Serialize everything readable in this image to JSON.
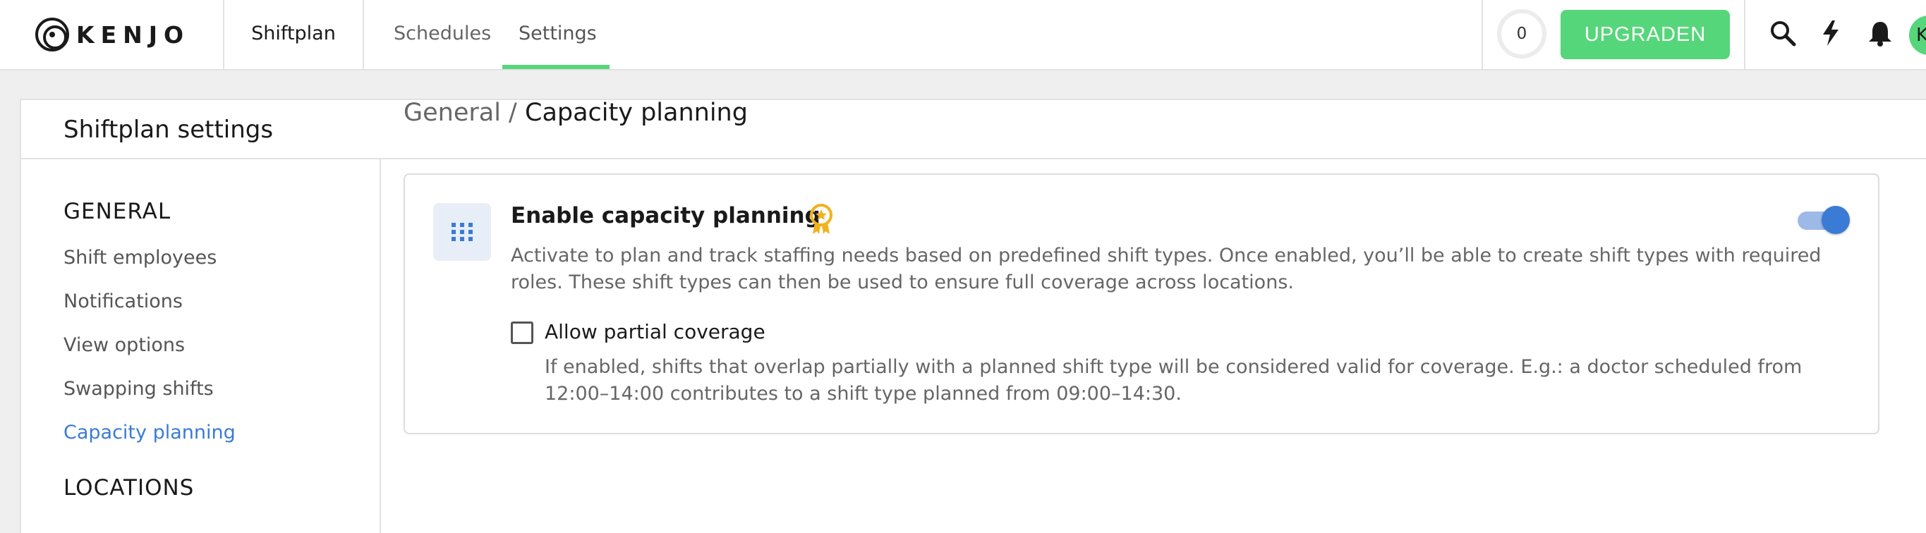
{
  "header": {
    "logo_text": "KENJO",
    "app_section": "Shiftplan",
    "tabs": [
      {
        "label": "Schedules"
      },
      {
        "label": "Settings",
        "active": true
      }
    ],
    "counter": "0",
    "upgrade_label": "UPGRADEN",
    "avatar_initial": "K",
    "icons": [
      "search-icon",
      "lightning-icon",
      "bell-icon"
    ]
  },
  "page": {
    "title": "Shiftplan settings"
  },
  "sidebar": {
    "general_heading": "GENERAL",
    "items": [
      {
        "label": "Shift employees"
      },
      {
        "label": "Notifications"
      },
      {
        "label": "View options"
      },
      {
        "label": "Swapping shifts"
      },
      {
        "label": "Capacity planning",
        "active": true
      }
    ],
    "locations_heading": "LOCATIONS"
  },
  "breadcrumb": {
    "root": "General /",
    "current": "Capacity planning"
  },
  "card": {
    "title": "Enable capacity planning",
    "description": "Activate to plan and track staffing needs based on predefined shift types. Once enabled, you’ll be able to create shift types with required roles. These shift types can then be used to ensure full coverage across locations.",
    "toggle_on": true,
    "option": {
      "label": "Allow partial coverage",
      "checked": false,
      "description": "If enabled, shifts that overlap partially with a planned shift type will be considered valid for coverage. E.g.: a doctor scheduled from 12:00–14:00 contributes to a shift type planned from 09:00–14:30."
    }
  },
  "colors": {
    "accent_green": "#56d67a",
    "accent_blue": "#3a7bd5",
    "badge_gold": "#f2b21c"
  }
}
